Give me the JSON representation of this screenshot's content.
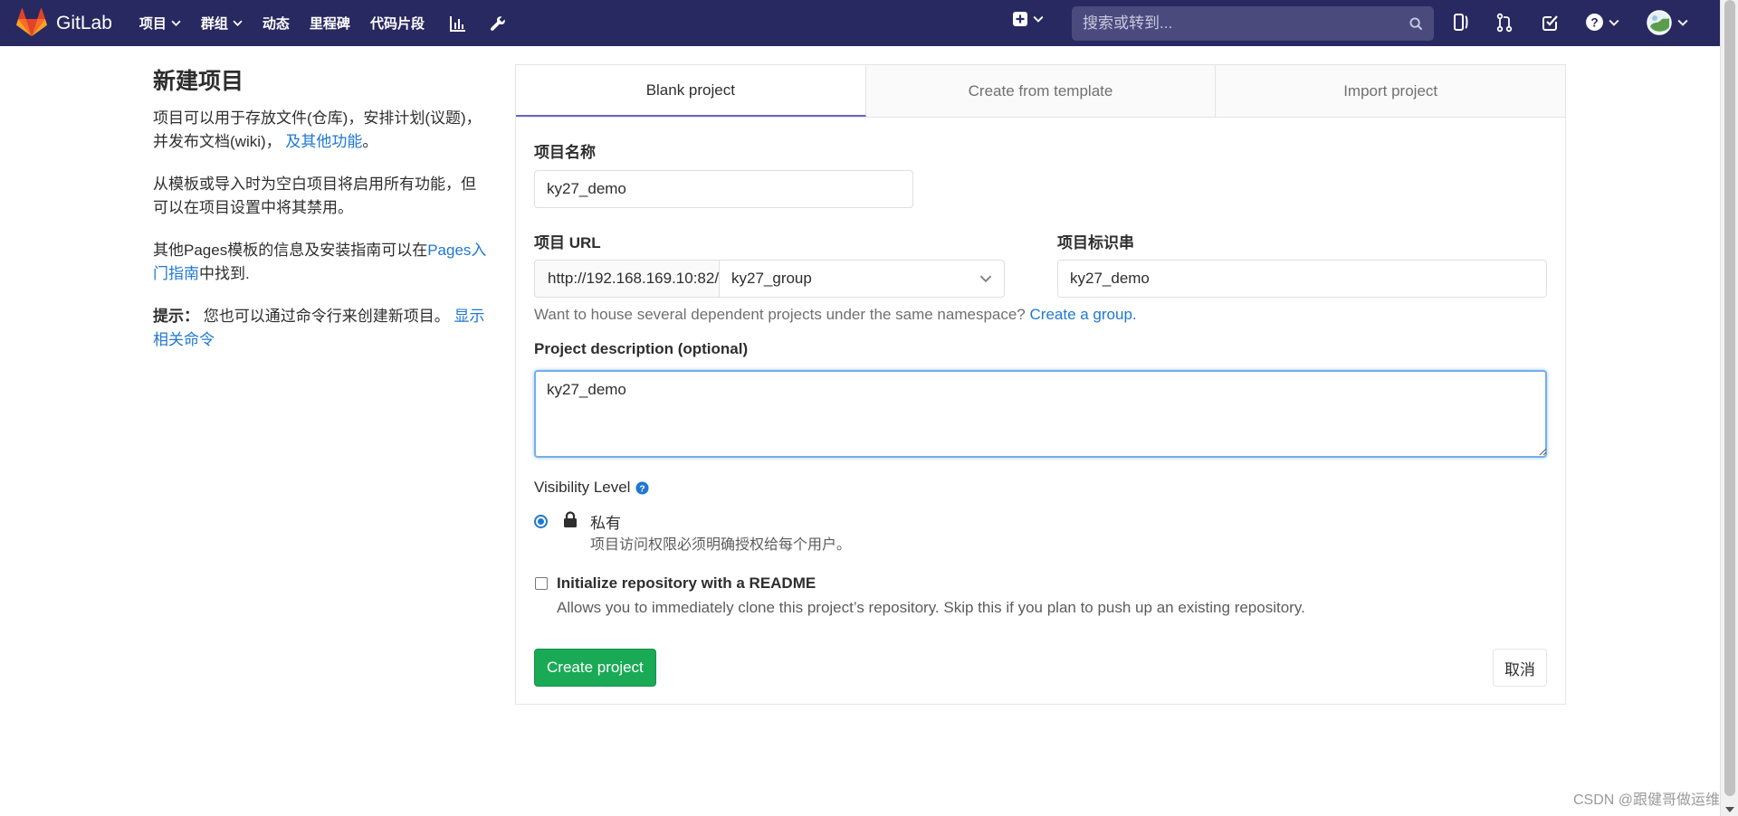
{
  "navbar": {
    "brand": "GitLab",
    "links": [
      {
        "label": "项目",
        "dropdown": true
      },
      {
        "label": "群组",
        "dropdown": true
      },
      {
        "label": "动态",
        "dropdown": false
      },
      {
        "label": "里程碑",
        "dropdown": false
      },
      {
        "label": "代码片段",
        "dropdown": false
      }
    ],
    "search_placeholder": "搜索或转到...",
    "icons": [
      "chart-icon",
      "wrench-icon",
      "plus-square-icon",
      "search-icon",
      "issues-icon",
      "merge-request-icon",
      "todo-check-icon",
      "help-icon",
      "user-avatar"
    ]
  },
  "info": {
    "title": "新建项目",
    "p1_text": "项目可以用于存放文件(仓库)，安排计划(议题)，并发布文档(wiki)，",
    "p1_link": "及其他功能",
    "p1_end": "。",
    "p2": "从模板或导入时为空白项目将启用所有功能，但可以在项目设置中将其禁用。",
    "p3_text": "其他Pages模板的信息及安装指南可以在",
    "p3_link": "Pages入门指南",
    "p3_end": "中找到.",
    "tip_label": "提示：",
    "tip_text": "您也可以通过命令行来创建新项目。",
    "tip_link": "显示相关命令"
  },
  "tabs": [
    {
      "label": "Blank project",
      "active": true
    },
    {
      "label": "Create from template",
      "active": false
    },
    {
      "label": "Import project",
      "active": false
    }
  ],
  "form": {
    "name_label": "项目名称",
    "name_value": "ky27_demo",
    "url_label": "项目 URL",
    "url_prefix": "http://192.168.169.10:82/",
    "namespace_value": "ky27_group",
    "slug_label": "项目标识串",
    "slug_value": "ky27_demo",
    "group_help_text": "Want to house several dependent projects under the same namespace?",
    "group_help_link": "Create a group.",
    "desc_label": "Project description (optional)",
    "desc_value": "ky27_demo",
    "visibility_label": "Visibility Level",
    "visibility_option": "私有",
    "visibility_help": "项目访问权限必须明确授权给每个用户。",
    "readme_label": "Initialize repository with a README",
    "readme_help": "Allows you to immediately clone this project’s repository. Skip this if you plan to push up an existing repository.",
    "create_button": "Create project",
    "cancel_button": "取消"
  },
  "watermark": "CSDN @跟健哥做运维",
  "colors": {
    "navbar": "#292961",
    "link": "#1f78d1",
    "create_button": "#1aaa55"
  }
}
